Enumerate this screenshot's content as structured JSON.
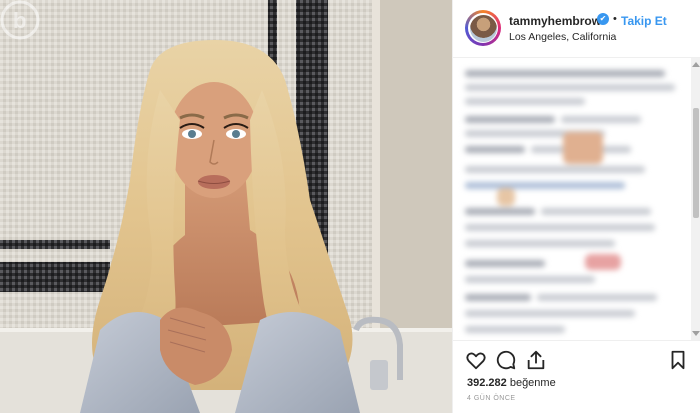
{
  "post": {
    "username": "tammyhembrow",
    "verified_mark": "✔",
    "separator": "•",
    "follow_label": "Takip Et",
    "location": "Los Angeles, California",
    "likes_count": "392.282",
    "likes_label": "beğenme",
    "time_ago": "4 GÜN ÖNCE"
  },
  "icons": {
    "like": "heart-icon",
    "comment": "comment-icon",
    "share": "share-icon",
    "save": "bookmark-icon",
    "verified": "verified-badge-icon"
  },
  "colors": {
    "accent": "#3897f0",
    "text": "#262626",
    "muted": "#999999"
  }
}
